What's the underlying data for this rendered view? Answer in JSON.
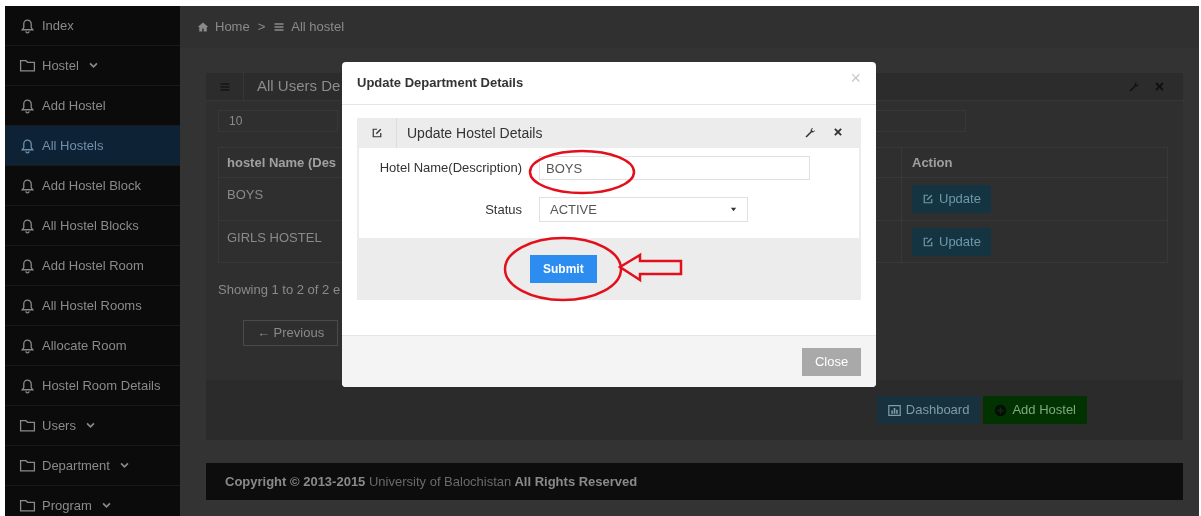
{
  "sidebar": {
    "items": [
      {
        "kind": "bell",
        "label": "Index",
        "selected": false
      },
      {
        "kind": "folder",
        "label": "Hostel",
        "selected": false,
        "expandable": true
      },
      {
        "kind": "bell",
        "label": "Add Hostel",
        "selected": false
      },
      {
        "kind": "bell",
        "label": "All Hostels",
        "selected": true
      },
      {
        "kind": "bell",
        "label": "Add Hostel Block",
        "selected": false
      },
      {
        "kind": "bell",
        "label": "All Hostel Blocks",
        "selected": false
      },
      {
        "kind": "bell",
        "label": "Add Hostel Room",
        "selected": false
      },
      {
        "kind": "bell",
        "label": "All Hostel Rooms",
        "selected": false
      },
      {
        "kind": "bell",
        "label": "Allocate Room",
        "selected": false
      },
      {
        "kind": "bell",
        "label": "Hostel Room Details",
        "selected": false
      },
      {
        "kind": "folder",
        "label": "Users",
        "selected": false,
        "expandable": true
      },
      {
        "kind": "folder",
        "label": "Department",
        "selected": false,
        "expandable": true
      },
      {
        "kind": "folder",
        "label": "Program",
        "selected": false,
        "expandable": true
      }
    ]
  },
  "breadcrumb": {
    "items": [
      {
        "kind": "home",
        "label": "Home"
      },
      {
        "kind": "list",
        "label": "All hostel"
      }
    ],
    "separator": ">"
  },
  "panel": {
    "title": "All Users De",
    "page_length": "10",
    "table": {
      "columns": [
        "hostel Name (Des",
        "Action"
      ],
      "rows": [
        {
          "name": "BOYS",
          "action": "Update"
        },
        {
          "name": "GIRLS HOSTEL",
          "action": "Update"
        }
      ]
    },
    "info": "Showing 1 to 2 of 2 e",
    "previous": "← Previous",
    "buttons": [
      {
        "kind": "dashboard",
        "label": "Dashboard"
      },
      {
        "kind": "add",
        "label": "Add Hostel"
      }
    ]
  },
  "footer": {
    "copyright": "Copyright © 2013-2015",
    "link": "University of Balochistan",
    "suffix": "All Rights Reserved"
  },
  "modal": {
    "title": "Update Department Details",
    "close_icon": "×",
    "widget_title": "Update Hostel Details",
    "fields": [
      {
        "kind": "text",
        "label": "Hotel Name(Description)",
        "value": "BOYS"
      },
      {
        "kind": "select",
        "label": "Status",
        "value": "ACTIVE"
      }
    ],
    "submit": "Submit",
    "close_button": "Close"
  }
}
